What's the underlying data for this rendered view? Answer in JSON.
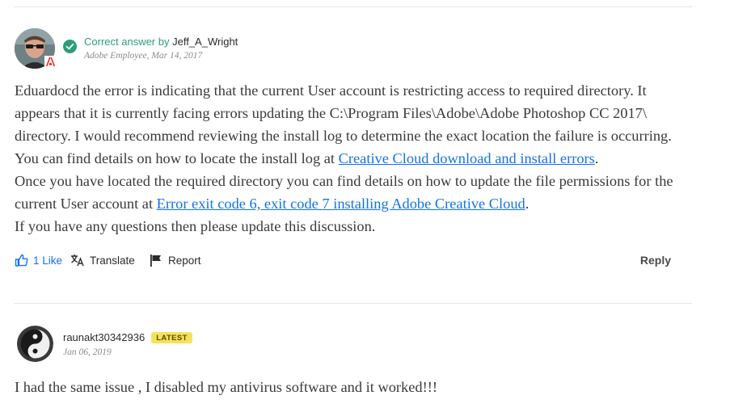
{
  "answer": {
    "status_label": "Correct answer by",
    "author": "Jeff_A_Wright",
    "role": "Adobe Employee",
    "date": "Mar 14, 2017",
    "lines": {
      "l1": "Eduardocd the error is indicating that the current User account is restricting access to required directory.  It",
      "l2": "appears that it is currently facing errors updating the C:\\Program Files\\Adobe\\Adobe Photoshop CC 2017\\",
      "l3": "directory.  I would recommend reviewing the install log to determine the exact location the failure is occurring.",
      "l4_pre": "You can find details on how to locate the install log at ",
      "l4_link": "Creative Cloud download and install errors",
      "l4_post": ".",
      "l5": "Once you have located the required directory you can find details on how to update the file permissions for the",
      "l6_pre": "current User account at ",
      "l6_link": "Error exit code 6, exit code 7 installing Adobe Creative Cloud",
      "l6_post": ".",
      "l7": "If you have any questions then please update this discussion."
    },
    "actions": {
      "like": "1 Like",
      "translate": "Translate",
      "report": "Report",
      "reply": "Reply"
    }
  },
  "reply": {
    "author": "raunakt30342936",
    "badge": "LATEST",
    "date": "Jan 06, 2019",
    "text": "I had the same issue , I disabled my antivirus software and it worked!!!"
  },
  "icons": {
    "check": "check-circle-icon",
    "adobe": "adobe-badge-icon",
    "like": "thumbs-up-icon",
    "translate": "translate-icon",
    "report": "flag-icon"
  },
  "colors": {
    "accent_green": "#2d9d78",
    "link_blue": "#1473e6",
    "badge_yellow": "#f5e25b",
    "adobe_red": "#eb1000"
  }
}
